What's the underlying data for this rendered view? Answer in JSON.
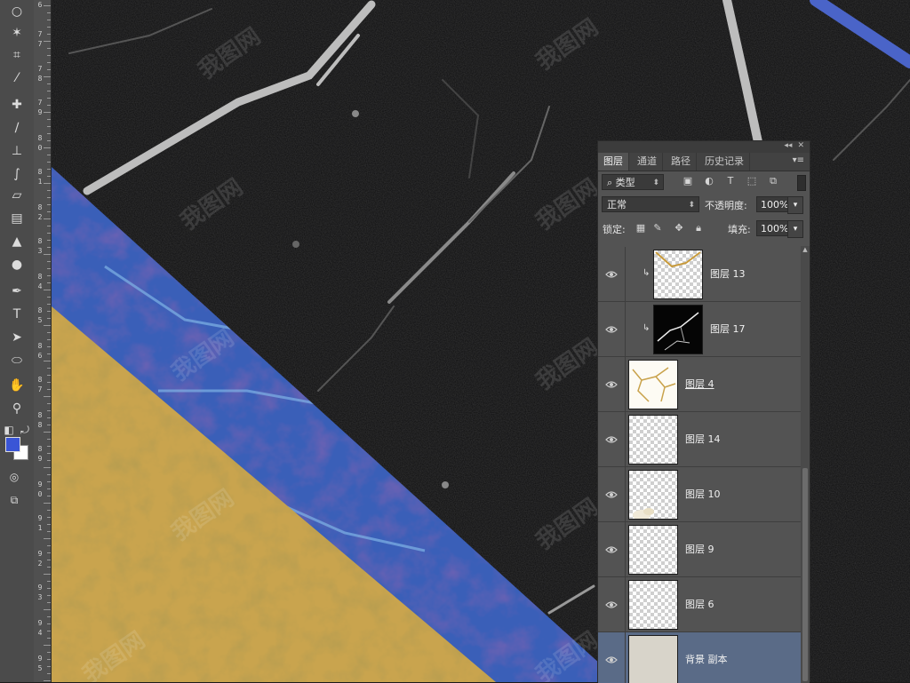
{
  "toolbox": {
    "tools": [
      {
        "name": "lasso-tool-icon",
        "glyph": "○"
      },
      {
        "name": "magic-wand-tool-icon",
        "glyph": "✶"
      },
      {
        "name": "crop-tool-icon",
        "glyph": "⌗"
      },
      {
        "name": "eyedropper-tool-icon",
        "glyph": "⁄"
      },
      {
        "name": "spot-healing-tool-icon",
        "glyph": "✚"
      },
      {
        "name": "brush-tool-icon",
        "glyph": "∕"
      },
      {
        "name": "clone-stamp-tool-icon",
        "glyph": "⊥"
      },
      {
        "name": "history-brush-tool-icon",
        "glyph": "∫"
      },
      {
        "name": "eraser-tool-icon",
        "glyph": "▱"
      },
      {
        "name": "gradient-tool-icon",
        "glyph": "▤"
      },
      {
        "name": "blur-tool-icon",
        "glyph": "▲"
      },
      {
        "name": "dodge-tool-icon",
        "glyph": "●"
      },
      {
        "name": "pen-tool-icon",
        "glyph": "✒"
      },
      {
        "name": "type-tool-icon",
        "glyph": "T"
      },
      {
        "name": "path-selection-tool-icon",
        "glyph": "➤"
      },
      {
        "name": "ellipse-tool-icon",
        "glyph": "⬭"
      },
      {
        "name": "hand-tool-icon",
        "glyph": "✋"
      },
      {
        "name": "zoom-tool-icon",
        "glyph": "⚲"
      }
    ],
    "foreground_color": "#3a55d6",
    "background_color": "#ffffff"
  },
  "ruler": {
    "labels": [
      "6",
      "7\n7",
      "7\n8",
      "7\n9",
      "8\n0",
      "8\n1",
      "8\n2",
      "8\n3",
      "8\n4",
      "8\n5",
      "8\n6",
      "8\n7",
      "8\n8",
      "8\n9",
      "9\n0",
      "9\n1",
      "9\n2",
      "9\n3",
      "9\n4",
      "9\n5"
    ]
  },
  "watermark": {
    "text": "我图网"
  },
  "layers_panel": {
    "tabs": [
      "图层",
      "通道",
      "路径",
      "历史记录"
    ],
    "active_tab": "图层",
    "filter_label": "类型",
    "blend_mode": "正常",
    "opacity_label": "不透明度:",
    "opacity_value": "100%",
    "lock_label": "锁定:",
    "fill_label": "填充:",
    "fill_value": "100%",
    "layers": [
      {
        "name": "图层 13",
        "clipped": true,
        "thumb": "gold-lines",
        "selected": false,
        "underline": false
      },
      {
        "name": "图层 17",
        "clipped": true,
        "thumb": "black-marble",
        "selected": false,
        "underline": false
      },
      {
        "name": "图层 4",
        "clipped": false,
        "thumb": "gold-veins",
        "selected": false,
        "underline": true
      },
      {
        "name": "图层 14",
        "clipped": false,
        "thumb": "transparent",
        "selected": false,
        "underline": false
      },
      {
        "name": "图层 10",
        "clipped": false,
        "thumb": "corner-blob",
        "selected": false,
        "underline": false
      },
      {
        "name": "图层 9",
        "clipped": false,
        "thumb": "transparent",
        "selected": false,
        "underline": false
      },
      {
        "name": "图层 6",
        "clipped": false,
        "thumb": "transparent",
        "selected": false,
        "underline": false
      },
      {
        "name": "背景 副本",
        "clipped": false,
        "thumb": "solid-beige",
        "selected": true,
        "underline": false
      }
    ]
  }
}
